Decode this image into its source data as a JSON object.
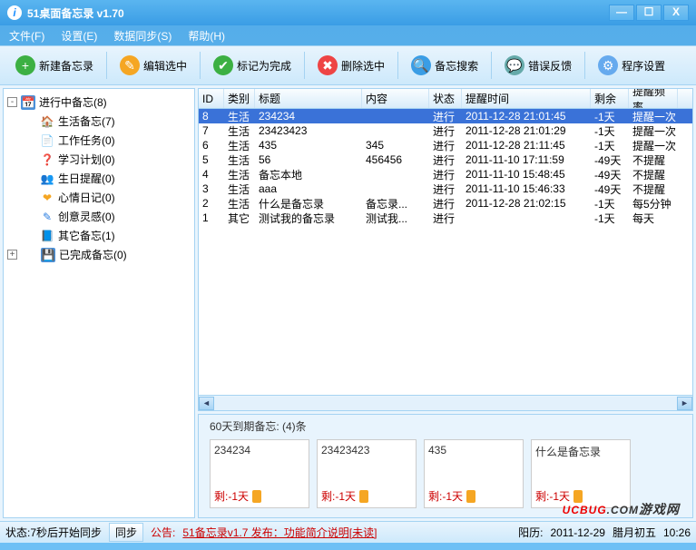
{
  "window": {
    "title": "51桌面备忘录  v1.70",
    "min": "—",
    "max": "☐",
    "close": "X"
  },
  "menu": [
    "文件(F)",
    "设置(E)",
    "数据同步(S)",
    "帮助(H)"
  ],
  "toolbar": [
    {
      "label": "新建备忘录",
      "color": "#3cb043",
      "glyph": "+"
    },
    {
      "label": "编辑选中",
      "color": "#f5a623",
      "glyph": "✎"
    },
    {
      "label": "标记为完成",
      "color": "#3cb043",
      "glyph": "✔"
    },
    {
      "label": "删除选中",
      "color": "#e44",
      "glyph": "✖"
    },
    {
      "label": "备忘搜索",
      "color": "#3a9de5",
      "glyph": "🔍"
    },
    {
      "label": "错误反馈",
      "color": "#6aa",
      "glyph": "💬"
    },
    {
      "label": "程序设置",
      "color": "#6ae",
      "glyph": "⚙"
    }
  ],
  "tree": {
    "root1": {
      "label": "进行中备忘(8)",
      "expander": "-"
    },
    "items": [
      {
        "ico": "🏠",
        "color": "#3a9de5",
        "label": "生活备忘(7)"
      },
      {
        "ico": "📄",
        "color": "#e68a00",
        "label": "工作任务(0)"
      },
      {
        "ico": "❓",
        "color": "#2a7de0",
        "label": "学习计划(0)"
      },
      {
        "ico": "👥",
        "color": "#e6b800",
        "label": "生日提醒(0)"
      },
      {
        "ico": "❤",
        "color": "#f5a623",
        "label": "心情日记(0)"
      },
      {
        "ico": "✎",
        "color": "#2a7de0",
        "label": "创意灵感(0)"
      },
      {
        "ico": "📘",
        "color": "#3a9de5",
        "label": "其它备忘(1)"
      }
    ],
    "root2": {
      "label": "已完成备忘(0)",
      "expander": "+"
    }
  },
  "table": {
    "headers": [
      "ID",
      "类别",
      "标题",
      "内容",
      "状态",
      "提醒时间",
      "剩余",
      "提醒频率"
    ],
    "rows": [
      {
        "sel": true,
        "id": "8",
        "cat": "生活",
        "title": "234234",
        "content": "",
        "status": "进行",
        "time": "2011-12-28 21:01:45",
        "remain": "-1天",
        "freq": "提醒一次"
      },
      {
        "id": "7",
        "cat": "生活",
        "title": "23423423",
        "content": "",
        "status": "进行",
        "time": "2011-12-28 21:01:29",
        "remain": "-1天",
        "freq": "提醒一次"
      },
      {
        "id": "6",
        "cat": "生活",
        "title": "435",
        "content": "345",
        "status": "进行",
        "time": "2011-12-28 21:11:45",
        "remain": "-1天",
        "freq": "提醒一次"
      },
      {
        "id": "5",
        "cat": "生活",
        "title": "56",
        "content": "456456",
        "status": "进行",
        "time": "2011-11-10 17:11:59",
        "remain": "-49天",
        "freq": "不提醒"
      },
      {
        "id": "4",
        "cat": "生活",
        "title": "备忘本地",
        "content": "",
        "status": "进行",
        "time": "2011-11-10 15:48:45",
        "remain": "-49天",
        "freq": "不提醒"
      },
      {
        "id": "3",
        "cat": "生活",
        "title": "aaa",
        "content": "",
        "status": "进行",
        "time": "2011-11-10 15:46:33",
        "remain": "-49天",
        "freq": "不提醒"
      },
      {
        "id": "2",
        "cat": "生活",
        "title": "什么是备忘录",
        "content": "备忘录...",
        "status": "进行",
        "time": "2011-12-28 21:02:15",
        "remain": "-1天",
        "freq": "每5分钟"
      },
      {
        "id": "1",
        "cat": "其它",
        "title": "测试我的备忘录",
        "content": "测试我...",
        "status": "进行",
        "time": "",
        "remain": "-1天",
        "freq": "每天"
      }
    ]
  },
  "expire": {
    "title": "60天到期备忘: (4)条",
    "cards": [
      {
        "title": "234234",
        "remain": "剩:-1天"
      },
      {
        "title": "23423423",
        "remain": "剩:-1天"
      },
      {
        "title": "435",
        "remain": "剩:-1天"
      },
      {
        "title": "什么是备忘录",
        "remain": "剩:-1天"
      }
    ]
  },
  "status": {
    "left": "状态:7秒后开始同步",
    "sync": "同步",
    "notice_label": "公告:",
    "notice": "51备忘录v1.7 发布：功能简介说明[未读]",
    "solar_label": "阳历:",
    "solar": "2011-12-29",
    "lunar_label": "腊月初五",
    "time": "10:26"
  },
  "watermark": {
    "u": "UCBUG",
    "com": ".COM",
    "tail": "游戏网"
  }
}
